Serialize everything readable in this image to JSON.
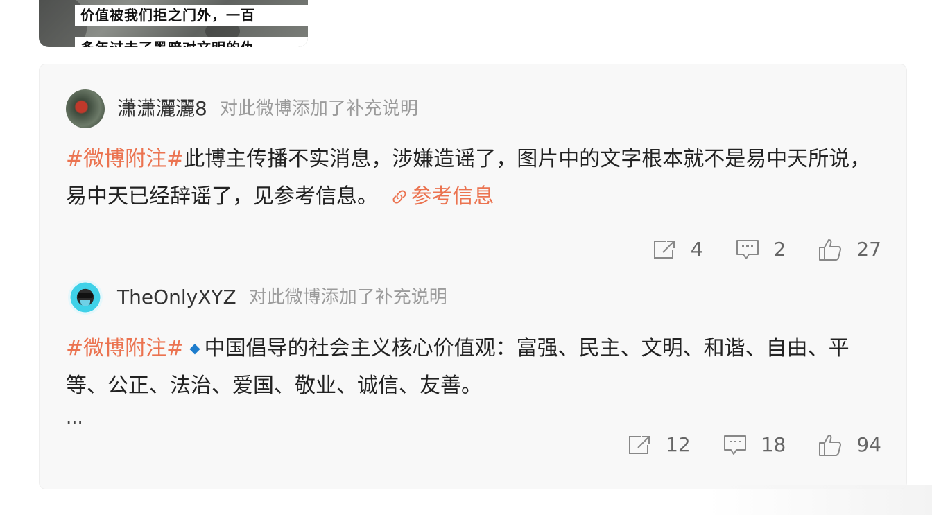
{
  "media": {
    "caption_line1": "价值被我们拒之门外，一百",
    "caption_line2": "多年过去了黑暗对文明的仇"
  },
  "notes": [
    {
      "username": "潇潇灑灑8",
      "action": "对此微博添加了补充说明",
      "topic": "#微博附注#",
      "text": "此博主传播不实消息，涉嫌造谣了，图片中的文字根本就不是易中天所说，易中天已经辞谣了，见参考信息。",
      "ref_label": "参考信息",
      "reposts": "4",
      "comments": "2",
      "likes": "27"
    },
    {
      "username": "TheOnlyXYZ",
      "action": "对此微博添加了补充说明",
      "topic": "#微博附注#",
      "bullet": "◆",
      "text": "中国倡导的社会主义核心价值观：富强、民主、文明、和谐、自由、平等、公正、法治、爱国、敬业、诚信、友善。",
      "ellipsis": "...",
      "reposts": "12",
      "comments": "18",
      "likes": "94"
    }
  ],
  "icons": {
    "repost": "share-icon",
    "comment": "comment-icon",
    "like": "thumbs-up-icon",
    "link": "link-icon"
  },
  "colors": {
    "topic": "#eb7350",
    "bullet": "#1d7ccc",
    "meta": "#9b9b9b"
  }
}
